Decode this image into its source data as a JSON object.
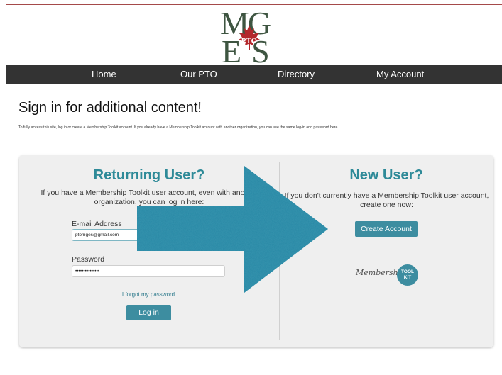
{
  "logo": {
    "top_letters": "MG",
    "bottom_letters": "ES",
    "badge": "PTO"
  },
  "nav": {
    "items": [
      {
        "label": "Home"
      },
      {
        "label": "Our PTO"
      },
      {
        "label": "Directory"
      },
      {
        "label": "My Account"
      }
    ]
  },
  "page": {
    "title": "Sign in for additional content!",
    "intro": "To fully access this site, log in or create a Membership Toolkit account. If you already have a Membership Toolkit account with another organization, you can use the same log-in and password here."
  },
  "returning": {
    "heading": "Returning User?",
    "description": "If you have a Membership Toolkit user account, even with another organization, you can log in here:",
    "email_label": "E-mail Address",
    "email_value": "ptomges@gmail.com",
    "password_label": "Password",
    "password_value": "•••••••••••••••",
    "forgot_link": "I forgot my password",
    "login_button": "Log in"
  },
  "new_user": {
    "heading": "New User?",
    "description": "If you don't currently have a Membership Toolkit user account, create one now:",
    "create_button": "Create Account"
  },
  "membership_toolkit": {
    "script_text": "Membership",
    "badge_line1": "TOOL",
    "badge_line2": "KIT"
  },
  "colors": {
    "accent": "#3d8da0",
    "heading": "#2e8a98",
    "nav_bg": "#333333",
    "logo_green": "#3e5541",
    "leaf_red": "#b3272b",
    "arrow": "#2a87a4"
  }
}
